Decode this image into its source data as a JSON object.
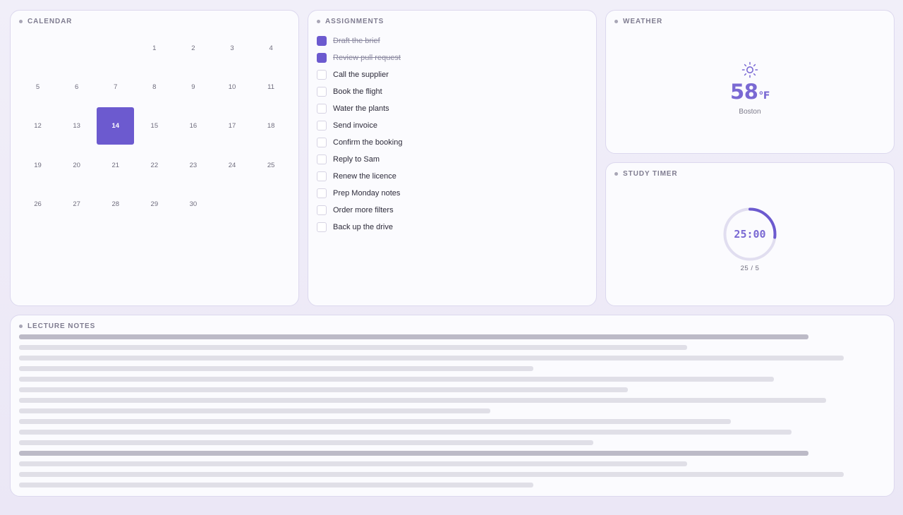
{
  "calendar": {
    "title": "CALENDAR",
    "days": [
      "",
      "",
      "",
      "1",
      "2",
      "3",
      "4",
      "5",
      "6",
      "7",
      "8",
      "9",
      "10",
      "11",
      "12",
      "13",
      "14",
      "15",
      "16",
      "17",
      "18",
      "19",
      "20",
      "21",
      "22",
      "23",
      "24",
      "25",
      "26",
      "27",
      "28",
      "29",
      "30"
    ],
    "selected": "14"
  },
  "assignments": {
    "title": "ASSIGNMENTS",
    "items": [
      {
        "label": "Draft the brief",
        "done": true
      },
      {
        "label": "Review pull request",
        "done": true
      },
      {
        "label": "Call the supplier",
        "done": false
      },
      {
        "label": "Book the flight",
        "done": false
      },
      {
        "label": "Water the plants",
        "done": false
      },
      {
        "label": "Send invoice",
        "done": false
      },
      {
        "label": "Confirm the booking",
        "done": false
      },
      {
        "label": "Reply to Sam",
        "done": false
      },
      {
        "label": "Renew the licence",
        "done": false
      },
      {
        "label": "Prep Monday notes",
        "done": false
      },
      {
        "label": "Order more filters",
        "done": false
      },
      {
        "label": "Back up the drive",
        "done": false
      }
    ]
  },
  "weather": {
    "title": "WEATHER",
    "icon": "sun-icon",
    "temp": "58",
    "unit": "°F",
    "city": "Boston"
  },
  "timer": {
    "title": "STUDY TIMER",
    "time": "25:00",
    "sub": "25 / 5",
    "progress": 0.27
  },
  "notes": {
    "title": "LECTURE NOTES",
    "lines": [
      {
        "w": 0.91,
        "head": true
      },
      {
        "w": 0.77,
        "head": false
      },
      {
        "w": 0.95,
        "head": false
      },
      {
        "w": 0.593,
        "head": false
      },
      {
        "w": 0.87,
        "head": false
      },
      {
        "w": 0.702,
        "head": false
      },
      {
        "w": 0.93,
        "head": false
      },
      {
        "w": 0.543,
        "head": false
      },
      {
        "w": 0.82,
        "head": false
      },
      {
        "w": 0.89,
        "head": false
      },
      {
        "w": 0.662,
        "head": false
      },
      {
        "w": 0.91,
        "head": true
      },
      {
        "w": 0.77,
        "head": false
      },
      {
        "w": 0.95,
        "head": false
      },
      {
        "w": 0.593,
        "head": false
      }
    ]
  },
  "colors": {
    "accent": "#6c5acf",
    "accent_text": "#7a69d3",
    "ring_track": "#e1def0"
  }
}
